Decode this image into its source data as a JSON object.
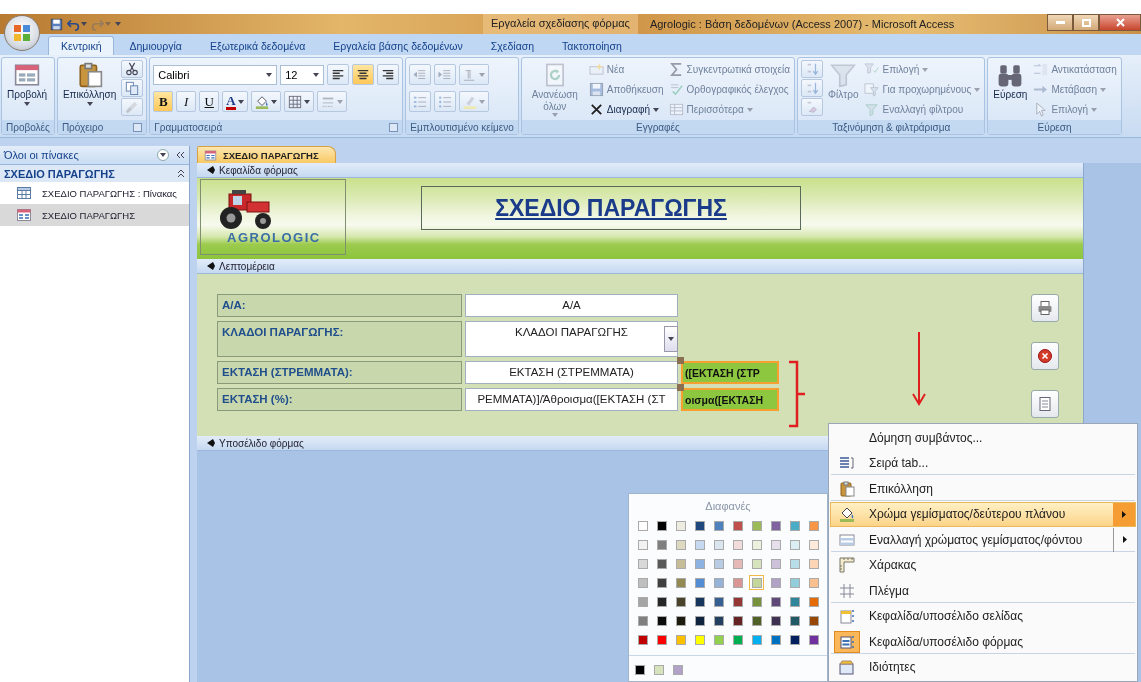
{
  "title_bar": {
    "context_tab": "Εργαλεία σχεδίασης φόρμας",
    "title": "Agrologic : Βάση δεδομένων (Access 2007) - Microsoft Access"
  },
  "ribbon_tabs": [
    {
      "label": "Κεντρική",
      "selected": true
    },
    {
      "label": "Δημιουργία",
      "selected": false
    },
    {
      "label": "Εξωτερικά δεδομένα",
      "selected": false
    },
    {
      "label": "Εργαλεία βάσης δεδομένων",
      "selected": false
    },
    {
      "label": "Σχεδίαση",
      "selected": false
    },
    {
      "label": "Τακτοποίηση",
      "selected": false
    }
  ],
  "ribbon_groups": [
    {
      "label": "Προβολές",
      "launcher": false,
      "columns": [
        {
          "kind": "large",
          "button": {
            "kind": "view",
            "label": "Προβολή",
            "disabled": false,
            "dropdown": true
          }
        }
      ]
    },
    {
      "label": "Πρόχειρο",
      "launcher": true,
      "columns": [
        {
          "kind": "large",
          "button": {
            "kind": "paste",
            "label": "Επικόλληση",
            "disabled": false,
            "dropdown": true
          }
        },
        {
          "kind": "stack",
          "items": [
            {
              "kind": "cut",
              "disabled": false
            },
            {
              "kind": "copy",
              "disabled": false
            },
            {
              "kind": "painter",
              "disabled": true
            }
          ]
        }
      ]
    },
    {
      "label": "Γραμματοσειρά",
      "launcher": true,
      "columns": [
        {
          "kind": "toolbars",
          "toolbars": [
            {
              "items": [
                {
                  "kind": "font-field",
                  "value": "Calibri"
                },
                {
                  "kind": "size-field",
                  "value": "12"
                },
                {
                  "kind": "align-left",
                  "selected": false,
                  "disabled": false
                },
                {
                  "kind": "align-center",
                  "selected": true,
                  "disabled": false
                },
                {
                  "kind": "align-right",
                  "selected": false,
                  "disabled": false
                }
              ]
            },
            {
              "items": [
                {
                  "kind": "bold",
                  "text": "B",
                  "selected": true,
                  "disabled": false
                },
                {
                  "kind": "italic",
                  "text": "I",
                  "selected": false,
                  "disabled": false
                },
                {
                  "kind": "underline",
                  "text": "U",
                  "selected": false,
                  "disabled": false
                },
                {
                  "kind": "font-color",
                  "text": "A",
                  "disabled": false,
                  "dropdown": true
                },
                {
                  "kind": "fill",
                  "disabled": false,
                  "dropdown": true
                },
                {
                  "kind": "gridlines",
                  "disabled": false,
                  "dropdown": true
                },
                {
                  "kind": "line",
                  "disabled": true,
                  "dropdown": true
                }
              ]
            }
          ]
        }
      ]
    },
    {
      "label": "Εμπλουτισμένο κείμενο",
      "launcher": false,
      "columns": [
        {
          "kind": "toolbars",
          "toolbars": [
            {
              "items": [
                {
                  "kind": "outdent",
                  "disabled": true
                },
                {
                  "kind": "indent",
                  "disabled": true
                },
                {
                  "kind": "ltr",
                  "disabled": true,
                  "dropdown": true
                }
              ]
            },
            {
              "items": [
                {
                  "kind": "numbering",
                  "disabled": true
                },
                {
                  "kind": "bullets",
                  "disabled": true
                },
                {
                  "kind": "highlight",
                  "disabled": true,
                  "dropdown": true
                }
              ]
            }
          ]
        }
      ]
    },
    {
      "label": "Εγγραφές",
      "launcher": false,
      "columns": [
        {
          "kind": "large",
          "button": {
            "kind": "refresh",
            "label": "Ανανέωση όλων",
            "disabled": true,
            "dropdown": true
          }
        },
        {
          "kind": "stack",
          "items": [
            {
              "kind": "new",
              "label": "Νέα",
              "disabled": true
            },
            {
              "kind": "save",
              "label": "Αποθήκευση",
              "disabled": true
            },
            {
              "kind": "delete",
              "label": "Διαγραφή",
              "disabled": false,
              "dropdown": true
            }
          ]
        },
        {
          "kind": "stack",
          "items": [
            {
              "kind": "sum",
              "label": "Συγκεντρωτικά στοιχεία",
              "disabled": true
            },
            {
              "kind": "spell",
              "label": "Ορθογραφικός έλεγχος",
              "disabled": true
            },
            {
              "kind": "more",
              "label": "Περισσότερα",
              "disabled": true,
              "dropdown": true
            }
          ]
        }
      ]
    },
    {
      "label": "Ταξινόμηση & φιλτράρισμα",
      "launcher": false,
      "columns": [
        {
          "kind": "stack",
          "items": [
            {
              "kind": "sort-asc",
              "disabled": true
            },
            {
              "kind": "sort-desc",
              "disabled": true
            },
            {
              "kind": "clear-sort",
              "disabled": true
            }
          ]
        },
        {
          "kind": "large",
          "button": {
            "kind": "filter",
            "label": "Φίλτρο",
            "disabled": true
          }
        },
        {
          "kind": "stack",
          "items": [
            {
              "kind": "selection",
              "label": "Επιλογή",
              "disabled": true,
              "dropdown": true
            },
            {
              "kind": "advanced",
              "label": "Για προχωρημένους",
              "disabled": true,
              "dropdown": true
            },
            {
              "kind": "toggle-filter",
              "label": "Εναλλαγή φίλτρου",
              "disabled": true
            }
          ]
        }
      ]
    },
    {
      "label": "Εύρεση",
      "launcher": false,
      "columns": [
        {
          "kind": "large",
          "button": {
            "kind": "find",
            "label": "Εύρεση",
            "disabled": false
          }
        },
        {
          "kind": "stack",
          "items": [
            {
              "kind": "replace",
              "label": "Αντικατάσταση",
              "disabled": true
            },
            {
              "kind": "goto",
              "label": "Μετάβαση",
              "disabled": true,
              "dropdown": true
            },
            {
              "kind": "select",
              "label": "Επιλογή",
              "disabled": true,
              "dropdown": true
            }
          ]
        }
      ]
    }
  ],
  "nav_pane": {
    "header": "Όλοι οι πίνακες",
    "group": "ΣΧΕΔΙΟ ΠΑΡΑΓΩΓΗΣ",
    "items": [
      {
        "kind": "table",
        "label": "ΣΧΕΔΙΟ ΠΑΡΑΓΩΓΗΣ : Πίνακας",
        "selected": false
      },
      {
        "kind": "form",
        "label": "ΣΧΕΔΙΟ ΠΑΡΑΓΩΓΗΣ",
        "selected": true
      }
    ]
  },
  "document_tab": "ΣΧΕΔΙΟ ΠΑΡΑΓΩΓΗΣ",
  "form": {
    "header_section": "Κεφαλίδα φόρμας",
    "logo_text": "AGROLOGIC",
    "title": "ΣΧΕΔΙΟ ΠΑΡΑΓΩΓΗΣ",
    "detail_section": "Λεπτομέρεια",
    "footer_section": "Υποσέλιδο φόρμας",
    "fields": [
      {
        "label": "Α/Α:",
        "kind": "textbox",
        "value": "Α/Α"
      },
      {
        "label": "ΚΛΑΔΟΙ ΠΑΡΑΓΩΓΗΣ:",
        "kind": "combo",
        "value": "ΚΛΑΔΟΙ ΠΑΡΑΓΩΓΗΣ"
      },
      {
        "label": "ΕΚΤΑΣΗ (ΣΤΡΕΜΜΑΤΑ):",
        "kind": "textbox",
        "value": "ΕΚΤΑΣΗ (ΣΤΡΕΜΜΑΤΑ)",
        "calc": {
          "value": "([ΕΚΤΑΣΗ (ΣΤΡ",
          "selected": true
        }
      },
      {
        "label": "ΕΚΤΑΣΗ  (%):",
        "kind": "textbox",
        "value": "ΡΕΜΜΑΤΑ)]/Άθροισμα([ΕΚΤΑΣΗ (ΣΤ",
        "calc": {
          "value": "οισμα([ΕΚΤΑΣΗ",
          "selected": true
        }
      }
    ],
    "buttons": [
      {
        "kind": "print"
      },
      {
        "kind": "close"
      },
      {
        "kind": "document"
      }
    ]
  },
  "color_palette": {
    "title": "Διαφανές",
    "rows": [
      [
        {
          "color": "#ffffff",
          "selected": false
        },
        {
          "color": "#000000",
          "selected": false
        },
        {
          "color": "#eeece1",
          "selected": false
        },
        {
          "color": "#1f497d",
          "selected": false
        },
        {
          "color": "#4f81bd",
          "selected": false
        },
        {
          "color": "#c0504d",
          "selected": false
        },
        {
          "color": "#9bbb59",
          "selected": false
        },
        {
          "color": "#8064a2",
          "selected": false
        },
        {
          "color": "#4bacc6",
          "selected": false
        },
        {
          "color": "#f79646",
          "selected": false
        }
      ],
      [
        {
          "color": "#f2f2f2",
          "selected": false
        },
        {
          "color": "#7f7f7f",
          "selected": false
        },
        {
          "color": "#ddd9c3",
          "selected": false
        },
        {
          "color": "#c6d9f0",
          "selected": false
        },
        {
          "color": "#dbe5f1",
          "selected": false
        },
        {
          "color": "#f2dcdb",
          "selected": false
        },
        {
          "color": "#ebf1dd",
          "selected": false
        },
        {
          "color": "#e5e0ec",
          "selected": false
        },
        {
          "color": "#dbeef3",
          "selected": false
        },
        {
          "color": "#fdeada",
          "selected": false
        }
      ],
      [
        {
          "color": "#d8d8d8",
          "selected": false
        },
        {
          "color": "#595959",
          "selected": false
        },
        {
          "color": "#c4bd97",
          "selected": false
        },
        {
          "color": "#8db3e2",
          "selected": false
        },
        {
          "color": "#b8cce4",
          "selected": false
        },
        {
          "color": "#e5b9b7",
          "selected": false
        },
        {
          "color": "#d7e3bc",
          "selected": false
        },
        {
          "color": "#ccc1d9",
          "selected": false
        },
        {
          "color": "#b7dde8",
          "selected": false
        },
        {
          "color": "#fbd5b5",
          "selected": false
        }
      ],
      [
        {
          "color": "#bfbfbf",
          "selected": false
        },
        {
          "color": "#3f3f3f",
          "selected": false
        },
        {
          "color": "#938953",
          "selected": false
        },
        {
          "color": "#548dd4",
          "selected": false
        },
        {
          "color": "#95b3d7",
          "selected": false
        },
        {
          "color": "#d99694",
          "selected": false
        },
        {
          "color": "#c3d69b",
          "selected": true
        },
        {
          "color": "#b2a2c7",
          "selected": false
        },
        {
          "color": "#92cddc",
          "selected": false
        },
        {
          "color": "#fac08f",
          "selected": false
        }
      ],
      [
        {
          "color": "#a5a5a5",
          "selected": false
        },
        {
          "color": "#262626",
          "selected": false
        },
        {
          "color": "#494429",
          "selected": false
        },
        {
          "color": "#17365d",
          "selected": false
        },
        {
          "color": "#366092",
          "selected": false
        },
        {
          "color": "#953734",
          "selected": false
        },
        {
          "color": "#76923c",
          "selected": false
        },
        {
          "color": "#5f497a",
          "selected": false
        },
        {
          "color": "#31859b",
          "selected": false
        },
        {
          "color": "#e36c09",
          "selected": false
        }
      ],
      [
        {
          "color": "#7f7f7f",
          "selected": false
        },
        {
          "color": "#0c0c0c",
          "selected": false
        },
        {
          "color": "#1d1b10",
          "selected": false
        },
        {
          "color": "#0f243e",
          "selected": false
        },
        {
          "color": "#244061",
          "selected": false
        },
        {
          "color": "#632423",
          "selected": false
        },
        {
          "color": "#4f6128",
          "selected": false
        },
        {
          "color": "#3f3151",
          "selected": false
        },
        {
          "color": "#205867",
          "selected": false
        },
        {
          "color": "#974806",
          "selected": false
        }
      ],
      [
        {
          "color": "#c00000",
          "selected": false
        },
        {
          "color": "#ff0000",
          "selected": false
        },
        {
          "color": "#ffc000",
          "selected": false
        },
        {
          "color": "#ffff00",
          "selected": false
        },
        {
          "color": "#92d050",
          "selected": false
        },
        {
          "color": "#00b050",
          "selected": false
        },
        {
          "color": "#00b0f0",
          "selected": false
        },
        {
          "color": "#0070c0",
          "selected": false
        },
        {
          "color": "#002060",
          "selected": false
        },
        {
          "color": "#7030a0",
          "selected": false
        }
      ]
    ],
    "recent": [
      {
        "color": "#000000",
        "selected": false
      },
      {
        "color": "#d7e3bc",
        "selected": false
      },
      {
        "color": "#b2a2c7",
        "selected": false
      }
    ]
  },
  "context_menu": [
    {
      "kind": "plain",
      "label": "Δόμηση συμβάντος...",
      "selected": false,
      "checked": false,
      "submenu": false,
      "group_end": false
    },
    {
      "kind": "tab-order",
      "label": "Σειρά tab...",
      "selected": false,
      "checked": false,
      "submenu": false,
      "group_end": true
    },
    {
      "kind": "paste",
      "label": "Επικόλληση",
      "selected": false,
      "checked": false,
      "submenu": false,
      "group_end": true
    },
    {
      "kind": "fill",
      "label": "Χρώμα γεμίσματος/δεύτερου πλάνου",
      "selected": true,
      "checked": false,
      "submenu": true,
      "group_end": false
    },
    {
      "kind": "alt-fill",
      "label": "Εναλλαγή χρώματος γεμίσματος/φόντου",
      "selected": false,
      "checked": false,
      "submenu": true,
      "group_end": true
    },
    {
      "kind": "ruler",
      "label": "Χάρακας",
      "selected": false,
      "checked": false,
      "submenu": false,
      "group_end": false
    },
    {
      "kind": "grid",
      "label": "Πλέγμα",
      "selected": false,
      "checked": false,
      "submenu": false,
      "group_end": true
    },
    {
      "kind": "page-header",
      "label": "Κεφαλίδα/υποσέλιδο σελίδας",
      "selected": false,
      "checked": false,
      "submenu": false,
      "group_end": false
    },
    {
      "kind": "form-header",
      "label": "Κεφαλίδα/υποσέλιδο φόρμας",
      "selected": false,
      "checked": true,
      "submenu": false,
      "group_end": true
    },
    {
      "kind": "properties",
      "label": "Ιδιότητες",
      "selected": false,
      "checked": false,
      "submenu": false,
      "group_end": false
    }
  ]
}
